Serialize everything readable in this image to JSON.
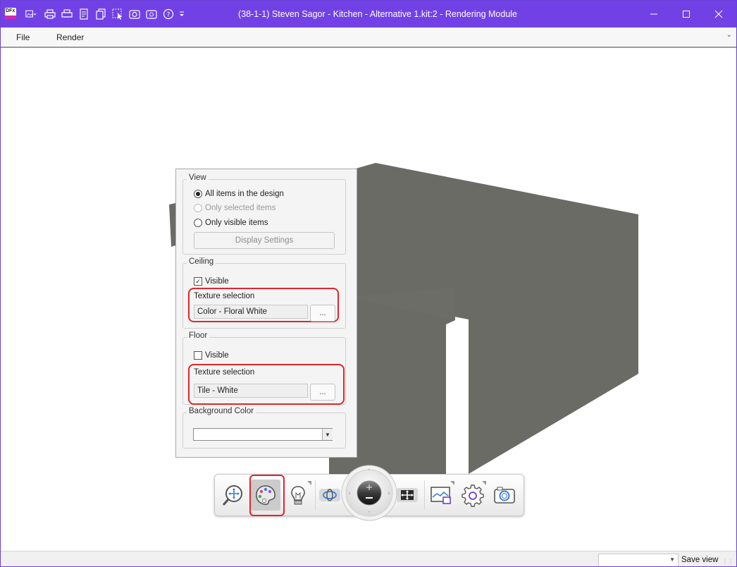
{
  "window": {
    "title": "(38-1-1) Steven Sagor - Kitchen - Alternative 1.kit:2 - Rendering Module",
    "app_icon": "DFx",
    "controls": [
      "minimize-icon",
      "maximize-icon",
      "close-icon"
    ],
    "quick_access": [
      "image-dropdown-icon",
      "print-icon",
      "print-preview-icon",
      "report-icon",
      "copy-icon",
      "select-icon",
      "screenshot-icon",
      "settings-camera-icon",
      "help-icon",
      "customize-dropdown-icon"
    ]
  },
  "menu": {
    "items": [
      "File",
      "Render"
    ]
  },
  "panel": {
    "view": {
      "title": "View",
      "options": [
        {
          "label": "All items in the design",
          "checked": true,
          "enabled": true
        },
        {
          "label": "Only selected items",
          "checked": false,
          "enabled": false
        },
        {
          "label": "Only visible items",
          "checked": false,
          "enabled": true
        }
      ],
      "display_settings_label": "Display Settings"
    },
    "ceiling": {
      "title": "Ceiling",
      "visible_label": "Visible",
      "visible_checked": true,
      "texture_label": "Texture selection",
      "texture_value": "Color - Floral White",
      "browse_label": "..."
    },
    "floor": {
      "title": "Floor",
      "visible_label": "Visible",
      "visible_checked": false,
      "texture_label": "Texture selection",
      "texture_value": "Tile - White",
      "browse_label": "..."
    },
    "background": {
      "title": "Background Color",
      "color_value": "#ffffff"
    }
  },
  "toolbar": {
    "buttons": [
      "zoom-pan-icon",
      "palette-icon",
      "lighting-icon",
      "orbit-icon",
      "navigation-wheel",
      "fit-view-icon",
      "background-image-icon",
      "settings-icon",
      "camera-icon"
    ],
    "active_button": "palette-icon"
  },
  "statusbar": {
    "save_view_label": "Save view",
    "view_select_value": ""
  },
  "colors": {
    "titlebar": "#7241e6",
    "highlight": "#e0262b",
    "wall": "#6b6b66"
  }
}
